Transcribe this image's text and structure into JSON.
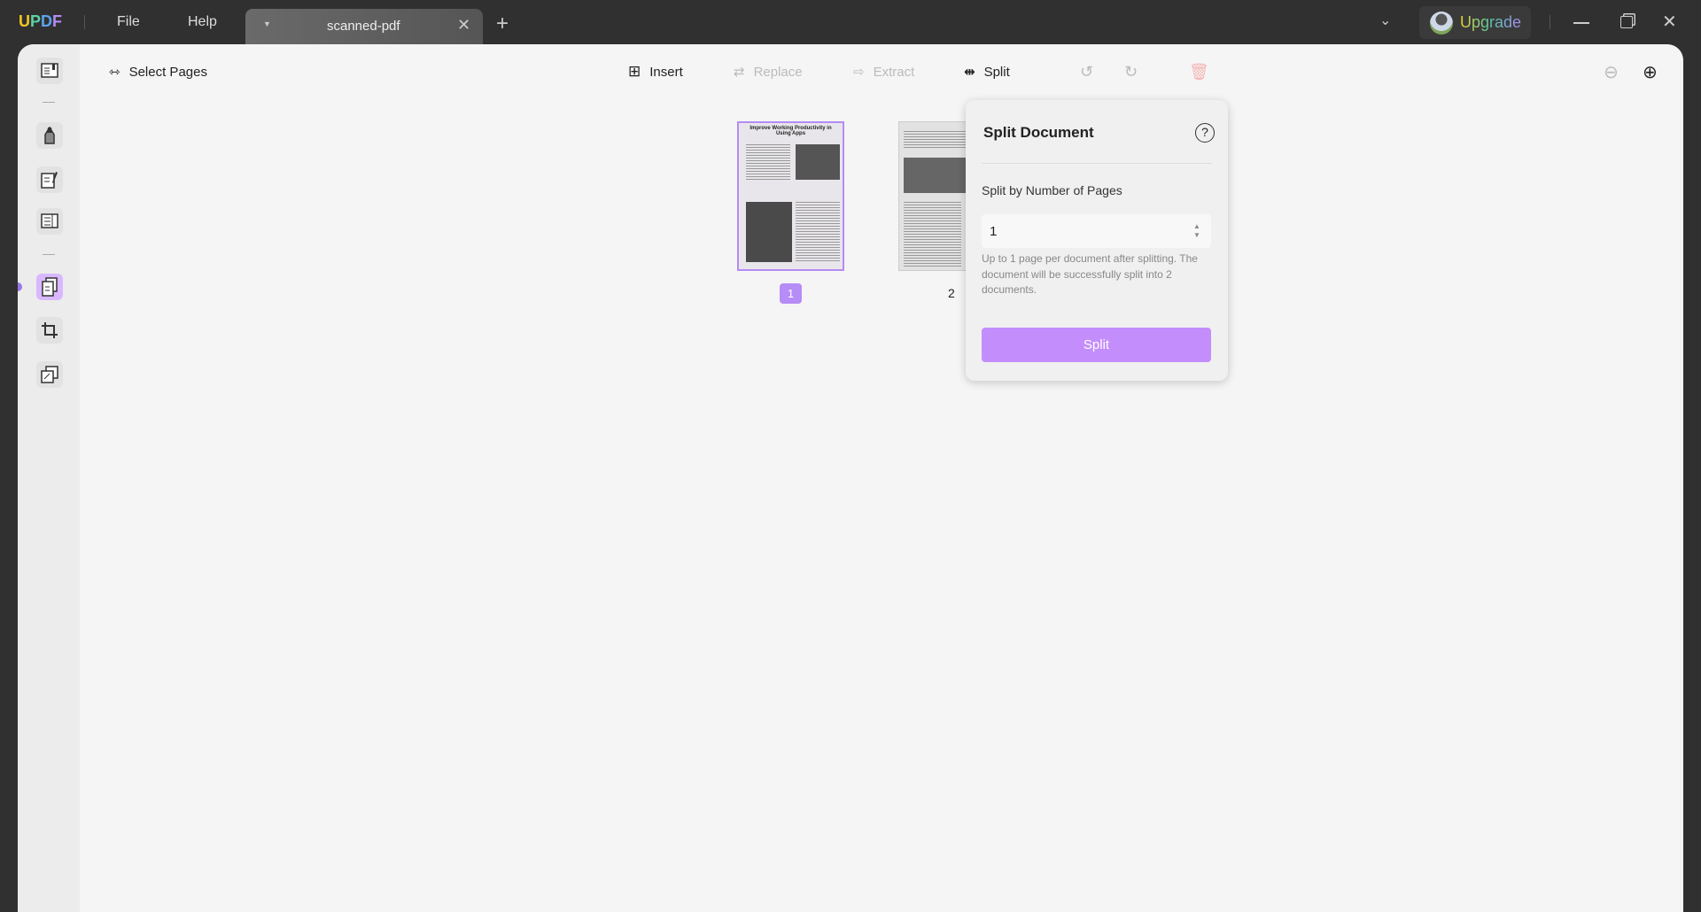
{
  "app": {
    "logo": "UPDF",
    "menu": [
      "File",
      "Help"
    ]
  },
  "tab": {
    "title": "scanned-pdf"
  },
  "account": {
    "upgrade_label": "Upgrade"
  },
  "toolbar": {
    "select_pages": "Select Pages",
    "insert": "Insert",
    "replace": "Replace",
    "extract": "Extract",
    "split": "Split"
  },
  "pages": [
    {
      "number": "1",
      "title": "Improve Working Productivity in Using Apps",
      "selected": true
    },
    {
      "number": "2",
      "selected": false
    }
  ],
  "split_popup": {
    "title": "Split Document",
    "label": "Split by Number of Pages",
    "value": "1",
    "hint": "Up to 1 page per document after splitting. The document will be successfully split into 2 documents.",
    "button": "Split"
  },
  "colors": {
    "accent": "#b68cf7",
    "button": "#c48dfc",
    "titlebar": "#303030"
  }
}
